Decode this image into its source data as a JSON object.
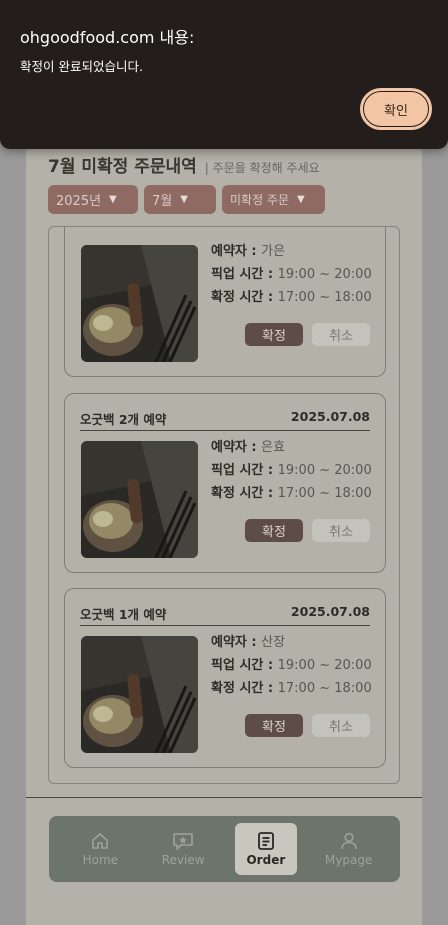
{
  "dialog": {
    "title": "ohgoodfood.com 내용:",
    "message": "확정이 완료되었습니다.",
    "ok_label": "확인"
  },
  "header": {
    "title": "7월 미확정 주문내역",
    "subtitle": "| 주문을 확정해 주세요"
  },
  "filters": {
    "year": "2025년",
    "month": "7월",
    "status": "미확정 주문"
  },
  "labels": {
    "reserver": "예약자 : ",
    "pickup_time": "픽업 시간 : ",
    "confirm_time": "확정 시간 : ",
    "confirm_button": "확정",
    "cancel_button": "취소"
  },
  "orders": [
    {
      "name": "",
      "date": "",
      "reserver": "가은",
      "pickup": "19:00 ~ 20:00",
      "confirm": "17:00 ~ 18:00"
    },
    {
      "name": "오굿백 2개 예약",
      "date": "2025.07.08",
      "reserver": "은효",
      "pickup": "19:00 ~ 20:00",
      "confirm": "17:00 ~ 18:00"
    },
    {
      "name": "오굿백 1개 예약",
      "date": "2025.07.08",
      "reserver": "산장",
      "pickup": "19:00 ~ 20:00",
      "confirm": "17:00 ~ 18:00"
    }
  ],
  "nav": {
    "items": [
      {
        "label": "Home",
        "icon": "home-icon"
      },
      {
        "label": "Review",
        "icon": "review-icon"
      },
      {
        "label": "Order",
        "icon": "order-icon",
        "active": true
      },
      {
        "label": "Mypage",
        "icon": "user-icon"
      }
    ]
  },
  "colors": {
    "dialog_bg": "#231e1b",
    "dialog_button": "#f2c6a4",
    "confirm_button": "#5e4d46",
    "nav_bg": "#6d746b"
  }
}
